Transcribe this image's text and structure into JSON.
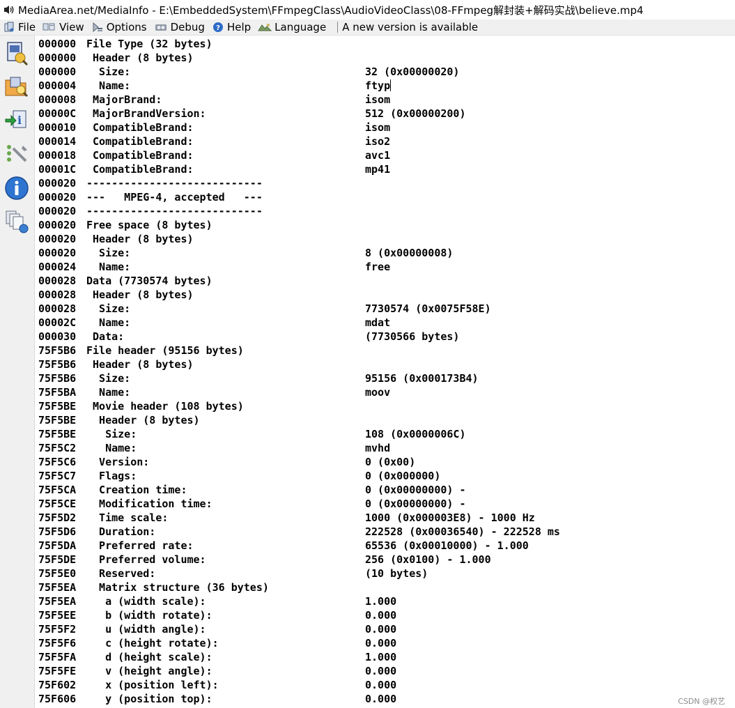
{
  "window": {
    "title": "MediaArea.net/MediaInfo - E:\\EmbeddedSystem\\FFmpegClass\\AudioVideoClass\\08-FFmpeg解封装+解码实战\\believe.mp4"
  },
  "menu": {
    "items": [
      {
        "label": "File",
        "icon": "file-icon"
      },
      {
        "label": "View",
        "icon": "view-icon"
      },
      {
        "label": "Options",
        "icon": "options-icon"
      },
      {
        "label": "Debug",
        "icon": "debug-icon"
      },
      {
        "label": "Help",
        "icon": "help-icon"
      },
      {
        "label": "Language",
        "icon": "language-icon"
      }
    ],
    "notice": "A new version is available"
  },
  "sidebar": {
    "buttons": [
      {
        "icon": "open-file-icon"
      },
      {
        "icon": "open-folder-icon"
      },
      {
        "icon": "export-icon"
      },
      {
        "icon": "preferences-icon"
      },
      {
        "icon": "about-icon"
      },
      {
        "icon": "knowledge-icon"
      }
    ]
  },
  "rows": [
    {
      "offset": "000000",
      "field": "File Type (32 bytes)",
      "value": ""
    },
    {
      "offset": "000000",
      "field": " Header (8 bytes)",
      "value": ""
    },
    {
      "offset": "000000",
      "field": "  Size:",
      "value": "32 (0x00000020)"
    },
    {
      "offset": "000004",
      "field": "  Name:",
      "value": "ftyp"
    },
    {
      "offset": "000008",
      "field": " MajorBrand:",
      "value": "isom"
    },
    {
      "offset": "00000C",
      "field": " MajorBrandVersion:",
      "value": "512 (0x00000200)"
    },
    {
      "offset": "000010",
      "field": " CompatibleBrand:",
      "value": "isom"
    },
    {
      "offset": "000014",
      "field": " CompatibleBrand:",
      "value": "iso2"
    },
    {
      "offset": "000018",
      "field": " CompatibleBrand:",
      "value": "avc1"
    },
    {
      "offset": "00001C",
      "field": " CompatibleBrand:",
      "value": "mp41"
    },
    {
      "offset": "000020",
      "field": "----------------------------",
      "value": ""
    },
    {
      "offset": "000020",
      "field": "---   MPEG-4, accepted   ---",
      "value": ""
    },
    {
      "offset": "000020",
      "field": "----------------------------",
      "value": ""
    },
    {
      "offset": "000020",
      "field": "Free space (8 bytes)",
      "value": ""
    },
    {
      "offset": "000020",
      "field": " Header (8 bytes)",
      "value": ""
    },
    {
      "offset": "000020",
      "field": "  Size:",
      "value": "8 (0x00000008)"
    },
    {
      "offset": "000024",
      "field": "  Name:",
      "value": "free"
    },
    {
      "offset": "000028",
      "field": "Data (7730574 bytes)",
      "value": ""
    },
    {
      "offset": "000028",
      "field": " Header (8 bytes)",
      "value": ""
    },
    {
      "offset": "000028",
      "field": "  Size:",
      "value": "7730574 (0x0075F58E)"
    },
    {
      "offset": "00002C",
      "field": "  Name:",
      "value": "mdat"
    },
    {
      "offset": "000030",
      "field": " Data:",
      "value": "(7730566 bytes)"
    },
    {
      "offset": "75F5B6",
      "field": "File header (95156 bytes)",
      "value": ""
    },
    {
      "offset": "75F5B6",
      "field": " Header (8 bytes)",
      "value": ""
    },
    {
      "offset": "75F5B6",
      "field": "  Size:",
      "value": "95156 (0x000173B4)"
    },
    {
      "offset": "75F5BA",
      "field": "  Name:",
      "value": "moov"
    },
    {
      "offset": "75F5BE",
      "field": " Movie header (108 bytes)",
      "value": ""
    },
    {
      "offset": "75F5BE",
      "field": "  Header (8 bytes)",
      "value": ""
    },
    {
      "offset": "75F5BE",
      "field": "   Size:",
      "value": "108 (0x0000006C)"
    },
    {
      "offset": "75F5C2",
      "field": "   Name:",
      "value": "mvhd"
    },
    {
      "offset": "75F5C6",
      "field": "  Version:",
      "value": "0 (0x00)"
    },
    {
      "offset": "75F5C7",
      "field": "  Flags:",
      "value": "0 (0x000000)"
    },
    {
      "offset": "75F5CA",
      "field": "  Creation time:",
      "value": "0 (0x00000000) -"
    },
    {
      "offset": "75F5CE",
      "field": "  Modification time:",
      "value": "0 (0x00000000) -"
    },
    {
      "offset": "75F5D2",
      "field": "  Time scale:",
      "value": "1000 (0x000003E8) - 1000 Hz"
    },
    {
      "offset": "75F5D6",
      "field": "  Duration:",
      "value": "222528 (0x00036540) - 222528 ms"
    },
    {
      "offset": "75F5DA",
      "field": "  Preferred rate:",
      "value": "65536 (0x00010000) - 1.000"
    },
    {
      "offset": "75F5DE",
      "field": "  Preferred volume:",
      "value": "256 (0x0100) - 1.000"
    },
    {
      "offset": "75F5E0",
      "field": "  Reserved:",
      "value": "(10 bytes)"
    },
    {
      "offset": "75F5EA",
      "field": "  Matrix structure (36 bytes)",
      "value": ""
    },
    {
      "offset": "75F5EA",
      "field": "   a (width scale):",
      "value": "1.000"
    },
    {
      "offset": "75F5EE",
      "field": "   b (width rotate):",
      "value": "0.000"
    },
    {
      "offset": "75F5F2",
      "field": "   u (width angle):",
      "value": "0.000"
    },
    {
      "offset": "75F5F6",
      "field": "   c (height rotate):",
      "value": "0.000"
    },
    {
      "offset": "75F5FA",
      "field": "   d (height scale):",
      "value": "1.000"
    },
    {
      "offset": "75F5FE",
      "field": "   v (height angle):",
      "value": "0.000"
    },
    {
      "offset": "75F602",
      "field": "   x (position left):",
      "value": "0.000"
    },
    {
      "offset": "75F606",
      "field": "   y (position top):",
      "value": "0.000"
    }
  ],
  "watermark": "CSDN @权艺"
}
